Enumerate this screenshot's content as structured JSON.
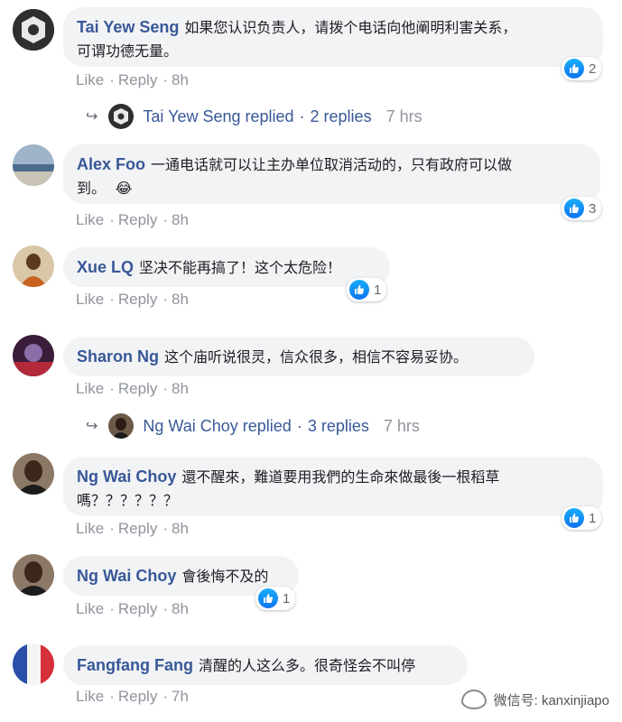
{
  "comments": [
    {
      "author": "Tai Yew Seng",
      "line1": "如果您认识负责人，请拨个电话向他阐明利害关系，",
      "line2": "可谓功德无量。",
      "like": "Like",
      "reply": "Reply",
      "time": "8h",
      "reactions": "2",
      "replies_row": {
        "name": "Tai Yew Seng replied",
        "count": "2 replies",
        "time": "7 hrs"
      }
    },
    {
      "author": "Alex Foo",
      "line1": "一通电话就可以让主办单位取消活动的，只有政府可以做",
      "line2": "到。",
      "emoji": "😂",
      "like": "Like",
      "reply": "Reply",
      "time": "8h",
      "reactions": "3"
    },
    {
      "author": "Xue LQ",
      "line1": "坚决不能再搞了！这个太危险！",
      "like": "Like",
      "reply": "Reply",
      "time": "8h",
      "reactions": "1"
    },
    {
      "author": "Sharon Ng",
      "line1": "这个庙听说很灵，信众很多，相信不容易妥协。",
      "like": "Like",
      "reply": "Reply",
      "time": "8h",
      "replies_row": {
        "name": "Ng Wai Choy replied",
        "count": "3 replies",
        "time": "7 hrs"
      }
    },
    {
      "author": "Ng Wai Choy",
      "line1": "還不醒來，難道要用我們的生命來做最後一根稻草",
      "line2": "嗎？？？？？？",
      "like": "Like",
      "reply": "Reply",
      "time": "8h",
      "reactions": "1"
    },
    {
      "author": "Ng Wai Choy",
      "line1": "會後悔不及的",
      "like": "Like",
      "reply": "Reply",
      "time": "8h",
      "reactions": "1"
    },
    {
      "author": "Fangfang Fang",
      "line1": "清醒的人这么多。很奇怪会不叫停",
      "like": "Like",
      "reply": "Reply",
      "time": "7h"
    }
  ],
  "separator": "·",
  "watermark": "微信号: kanxinjiapo",
  "colors": {
    "author": "#385898",
    "bubble": "#f2f3f5",
    "meta": "#90949c",
    "like_blue": "#1877f2"
  }
}
